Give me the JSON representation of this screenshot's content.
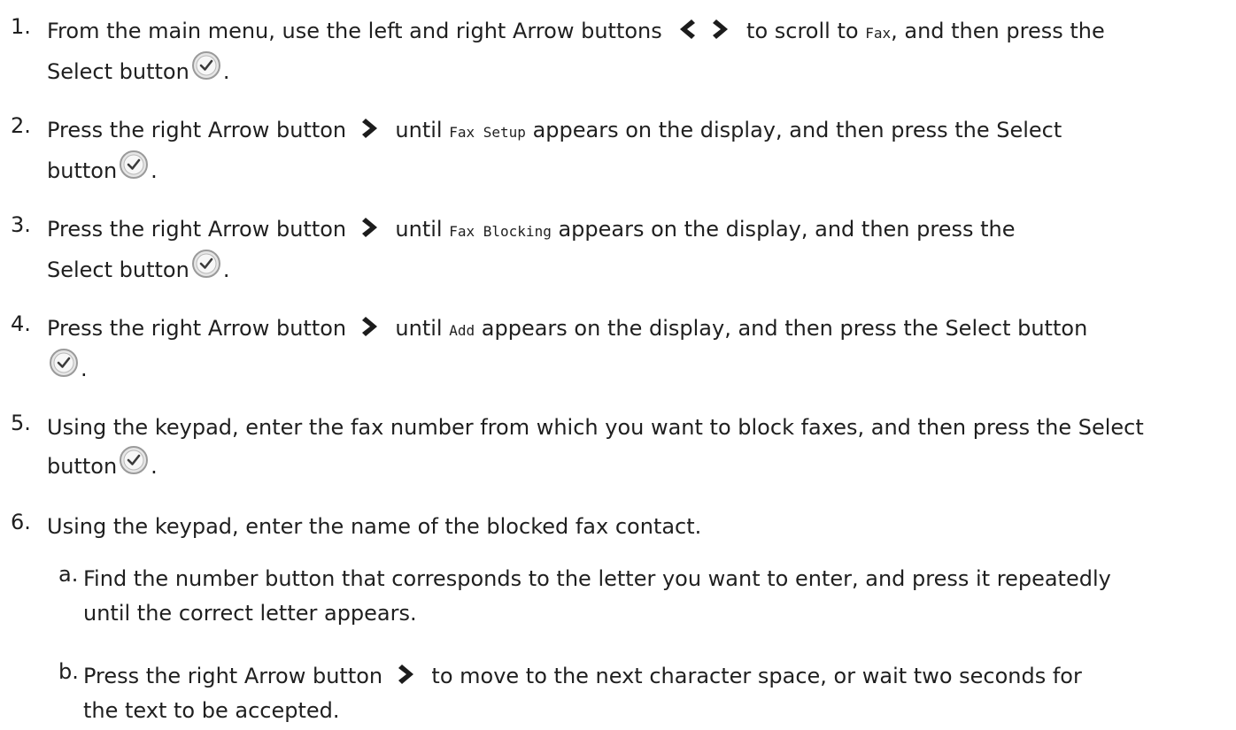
{
  "steps": [
    {
      "num": "1.",
      "a": "From the main menu, use the left and right Arrow buttons",
      "b": "to scroll to",
      "code": "Fax",
      "c": ", and then press the",
      "d": "Select button",
      "e": "."
    },
    {
      "num": "2.",
      "a": "Press the right Arrow button",
      "b": "until",
      "code": "Fax Setup",
      "c": "appears on the display, and then press the Select",
      "d": "button",
      "e": "."
    },
    {
      "num": "3.",
      "a": "Press the right Arrow button",
      "b": "until",
      "code": "Fax Blocking",
      "c": "appears on the display,  and then press the",
      "d": "Select button",
      "e": "."
    },
    {
      "num": "4.",
      "a": "Press the right Arrow button",
      "b": "until",
      "code": "Add",
      "c": "appears on the display, and then press the Select button",
      "e": "."
    },
    {
      "num": "5.",
      "a": "Using the keypad, enter the fax number from which you want to block faxes, and then press the Select",
      "d": "button",
      "e": "."
    },
    {
      "num": "6.",
      "a": "Using the keypad, enter the name of the blocked fax contact."
    }
  ],
  "substeps": [
    {
      "num": "a.",
      "a": "Find the number button that corresponds to the letter you want to enter, and press it repeatedly",
      "b": "until the correct letter appears."
    },
    {
      "num": "b.",
      "a": "Press the right Arrow button",
      "b": "to move to the next character space, or wait two seconds for",
      "c": "the text to be accepted."
    }
  ],
  "icons": {
    "left_arrow": "left-arrow-icon",
    "right_arrow": "right-arrow-icon",
    "select": "select-button-icon"
  },
  "colors": {
    "text": "#1f1f1f",
    "arrow": "#1c1c1c",
    "select_ring": "#9a9a9a",
    "select_fill": "#e6e6e6"
  }
}
